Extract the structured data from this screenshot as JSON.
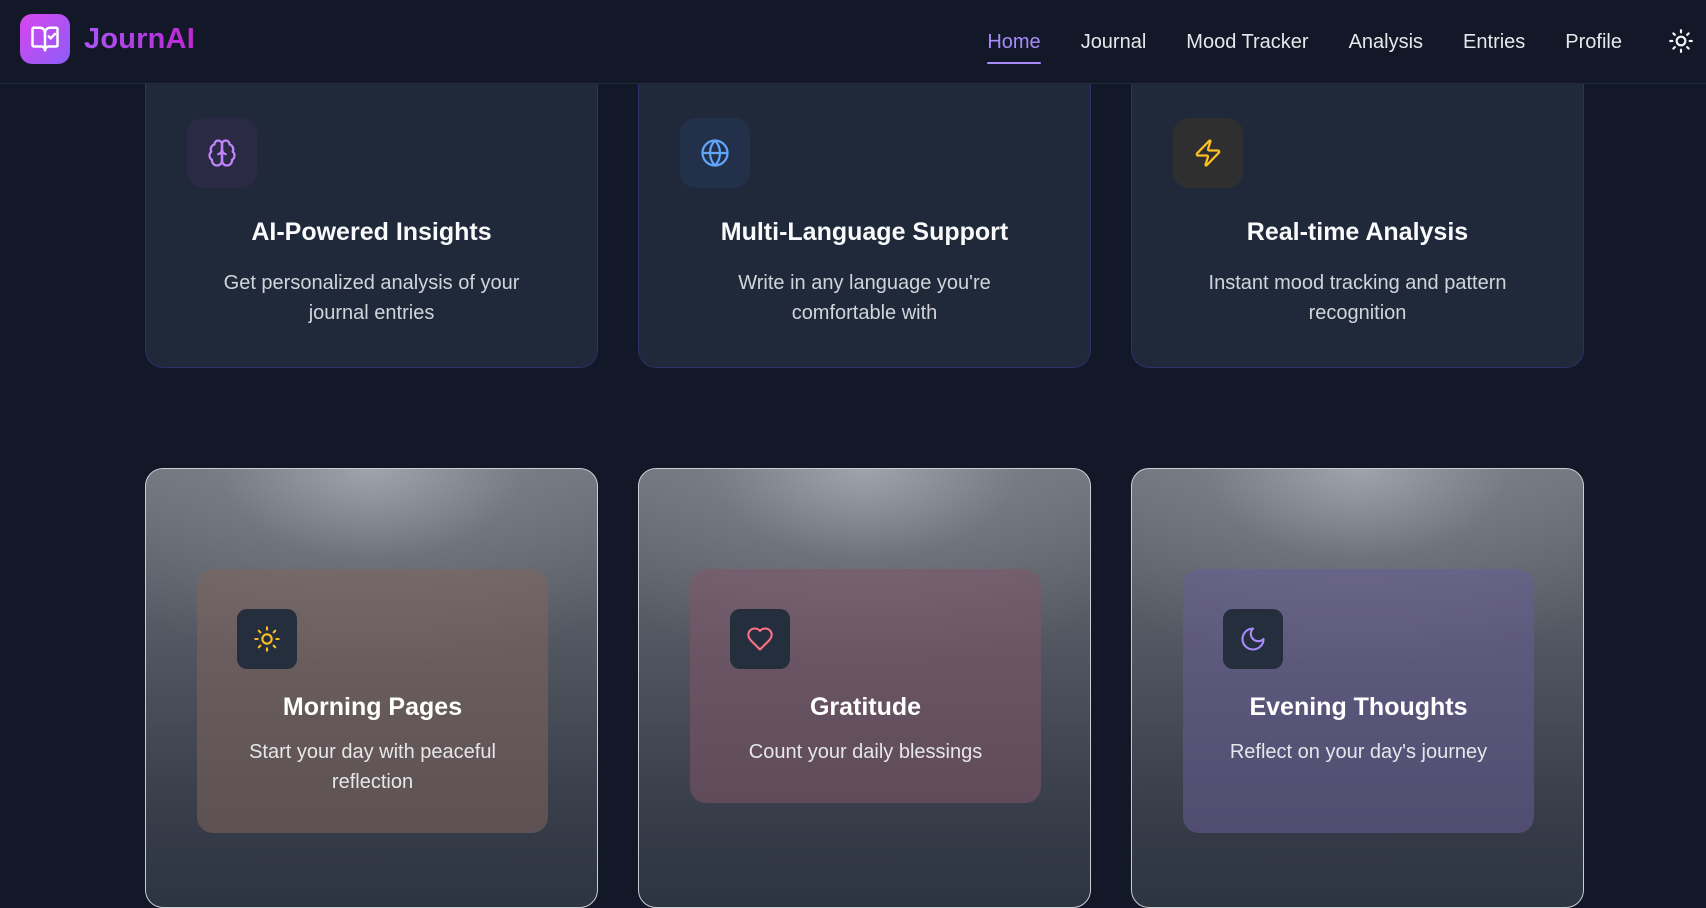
{
  "brand": {
    "name": "JournAI"
  },
  "nav": {
    "items": [
      {
        "label": "Home",
        "active": true
      },
      {
        "label": "Journal",
        "active": false
      },
      {
        "label": "Mood Tracker",
        "active": false
      },
      {
        "label": "Analysis",
        "active": false
      },
      {
        "label": "Entries",
        "active": false
      },
      {
        "label": "Profile",
        "active": false
      }
    ]
  },
  "features": [
    {
      "icon": "brain-icon",
      "title": "AI-Powered Insights",
      "description": "Get personalized analysis of your journal entries",
      "color": "#c084fc"
    },
    {
      "icon": "globe-icon",
      "title": "Multi-Language Support",
      "description": "Write in any language you're comfortable with",
      "color": "#60a5fa"
    },
    {
      "icon": "lightning-icon",
      "title": "Real-time Analysis",
      "description": "Instant mood tracking and pattern recognition",
      "color": "#fbbf24"
    }
  ],
  "prompts": [
    {
      "icon": "sun-icon",
      "title": "Morning Pages",
      "description": "Start your day with peaceful reflection",
      "color": "#fbbf24"
    },
    {
      "icon": "heart-icon",
      "title": "Gratitude",
      "description": "Count your daily blessings",
      "color": "#fb7185"
    },
    {
      "icon": "moon-icon",
      "title": "Evening Thoughts",
      "description": "Reflect on your day's journey",
      "color": "#a78bfa"
    }
  ],
  "colors": {
    "background": "#121827",
    "card": "#1f2939",
    "accent": "#a78bfa",
    "brand_gradient_start": "#d946ef",
    "brand_gradient_end": "#8b5cf6"
  }
}
